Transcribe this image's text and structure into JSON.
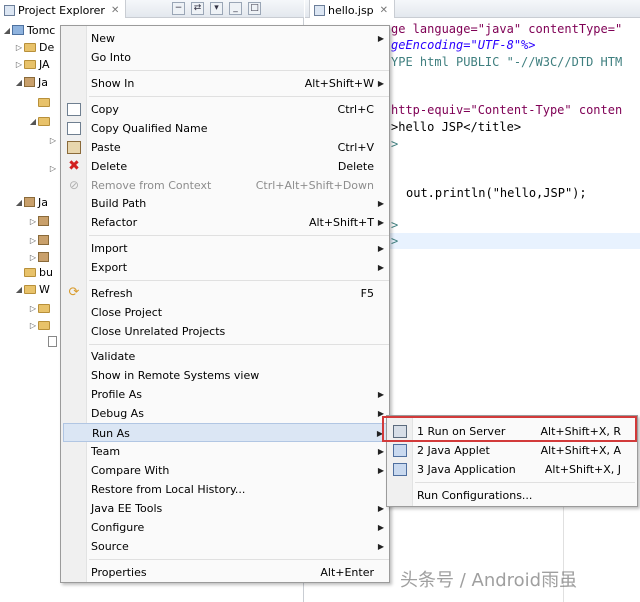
{
  "explorer": {
    "title": "Project Explorer",
    "tree": [
      {
        "text": "Tomc"
      },
      {
        "text": "De"
      },
      {
        "text": "JA"
      },
      {
        "text": "Ja"
      },
      {
        "text": "Ja"
      },
      {
        "text": "bu"
      },
      {
        "text": "W"
      }
    ]
  },
  "editor": {
    "tab_title": "hello.jsp",
    "lines": [
      "ge language=\"java\" contentType=\"",
      "geEncoding=\"UTF-8\"%>",
      "YPE html PUBLIC \"-//W3C//DTD HTM",
      "http-equiv=\"Content-Type\" conten",
      ">hello JSP</title>",
      ">",
      "out.println(\"hello,JSP\");",
      ">",
      ">"
    ]
  },
  "context_menu": {
    "items": [
      {
        "label": "New",
        "accel": "",
        "submenu": true
      },
      {
        "label": "Go Into",
        "accel": ""
      },
      {
        "label": "Show In",
        "accel": "Alt+Shift+W",
        "submenu": true
      },
      {
        "label": "Copy",
        "accel": "Ctrl+C",
        "icon": "copy-icon"
      },
      {
        "label": "Copy Qualified Name",
        "accel": "",
        "icon": "copy-qualified-name-icon"
      },
      {
        "label": "Paste",
        "accel": "Ctrl+V",
        "icon": "paste-icon"
      },
      {
        "label": "Delete",
        "accel": "Delete",
        "icon": "delete-icon"
      },
      {
        "label": "Remove from Context",
        "accel": "Ctrl+Alt+Shift+Down",
        "icon": "remove-from-context-icon",
        "disabled": true
      },
      {
        "label": "Build Path",
        "accel": "",
        "submenu": true
      },
      {
        "label": "Refactor",
        "accel": "Alt+Shift+T",
        "submenu": true
      },
      {
        "label": "Import",
        "accel": "",
        "submenu": true
      },
      {
        "label": "Export",
        "accel": "",
        "submenu": true
      },
      {
        "label": "Refresh",
        "accel": "F5",
        "icon": "refresh-icon"
      },
      {
        "label": "Close Project",
        "accel": ""
      },
      {
        "label": "Close Unrelated Projects",
        "accel": ""
      },
      {
        "label": "Validate",
        "accel": ""
      },
      {
        "label": "Show in Remote Systems view",
        "accel": ""
      },
      {
        "label": "Profile As",
        "accel": "",
        "submenu": true
      },
      {
        "label": "Debug As",
        "accel": "",
        "submenu": true
      },
      {
        "label": "Run As",
        "accel": "",
        "submenu": true,
        "hover": true
      },
      {
        "label": "Team",
        "accel": "",
        "submenu": true
      },
      {
        "label": "Compare With",
        "accel": "",
        "submenu": true
      },
      {
        "label": "Restore from Local History...",
        "accel": ""
      },
      {
        "label": "Java EE Tools",
        "accel": "",
        "submenu": true
      },
      {
        "label": "Configure",
        "accel": "",
        "submenu": true
      },
      {
        "label": "Source",
        "accel": "",
        "submenu": true
      },
      {
        "label": "Properties",
        "accel": "Alt+Enter"
      }
    ]
  },
  "run_as_submenu": {
    "items": [
      {
        "label": "1 Run on Server",
        "accel": "Alt+Shift+X, R",
        "icon": "run-on-server-icon"
      },
      {
        "label": "2 Java Applet",
        "accel": "Alt+Shift+X, A",
        "icon": "java-applet-icon"
      },
      {
        "label": "3 Java Application",
        "accel": "Alt+Shift+X, J",
        "icon": "java-application-icon"
      },
      {
        "label": "Run Configurations...",
        "accel": ""
      }
    ]
  },
  "watermark": "头条号 / Android雨虽"
}
